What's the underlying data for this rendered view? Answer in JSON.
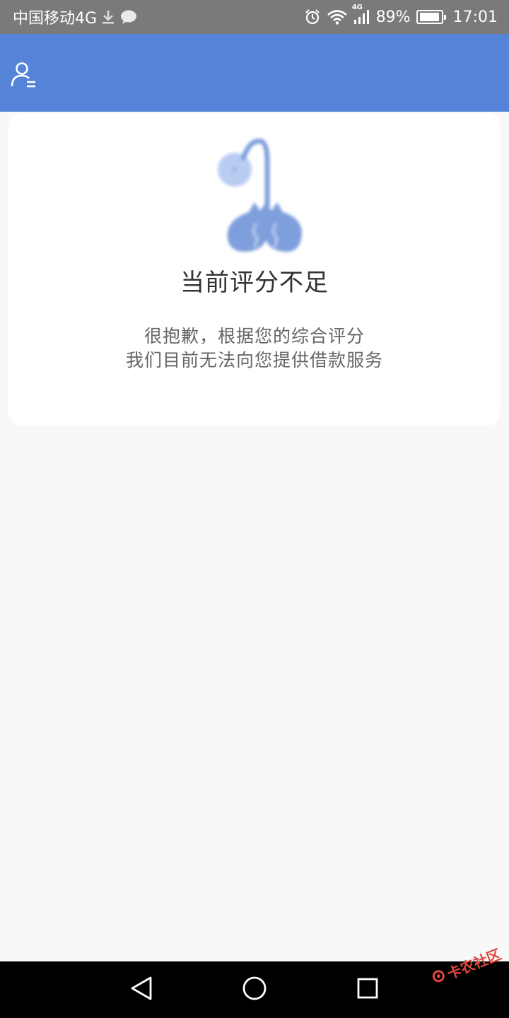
{
  "status_bar": {
    "carrier": "中国移动4G",
    "network_small": "4G",
    "battery_percent": "89%",
    "battery_level": 0.89,
    "time": "17:01",
    "icons": [
      "download-icon",
      "chat-bubble-icon",
      "alarm-icon",
      "wifi-icon",
      "signal-icon",
      "battery-icon"
    ]
  },
  "header": {
    "user_icon": "user-menu-icon",
    "background": "#5483d8"
  },
  "card": {
    "illustration": "crying-lamp-illustration",
    "title": "当前评分不足",
    "message_line1": "很抱歉，根据您的综合评分",
    "message_line2": "我们目前无法向您提供借款服务"
  },
  "nav_bar": {
    "buttons": [
      "back-triangle-icon",
      "home-circle-icon",
      "recent-square-icon"
    ]
  },
  "watermark": {
    "text": "卡农社区"
  },
  "colors": {
    "accent": "#5483d8",
    "status_bar": "#7a7a7a",
    "page_bg": "#f8f8f8",
    "title": "#333333",
    "message": "#666666",
    "watermark": "#e0463c"
  }
}
